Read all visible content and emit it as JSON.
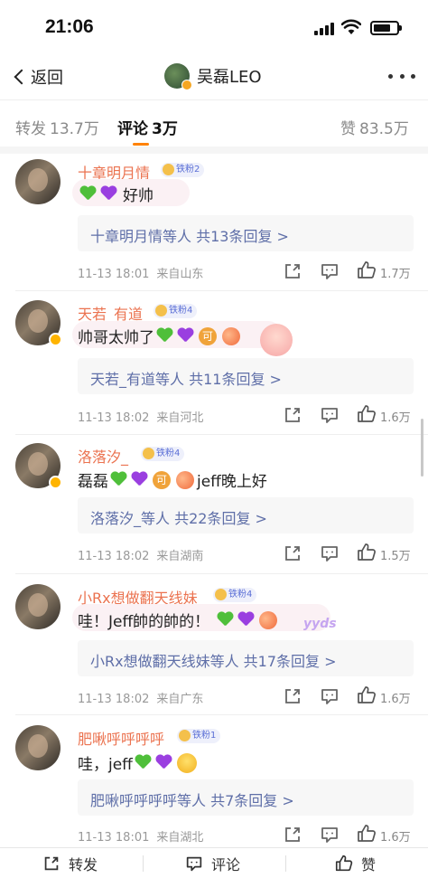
{
  "status_bar": {
    "time": "21:06"
  },
  "nav": {
    "back_label": "返回",
    "user_name": "吴磊LEO"
  },
  "tabs": {
    "repost_label": "转发",
    "repost_count": "13.7万",
    "comment_label": "评论",
    "comment_count": "3万",
    "like_label": "赞",
    "like_count": "83.5万"
  },
  "comments": [
    {
      "username": "十章明月情",
      "fan_badge": "铁粉2",
      "text": "好帅",
      "reply_summary": "十章明月情等人  共13条回复 >",
      "time": "11-13 18:01",
      "location": "来自山东",
      "likes": "1.7万"
    },
    {
      "username": "天若_有道",
      "fan_badge": "铁粉4",
      "text": "帅哥太帅了",
      "reply_summary": "天若_有道等人  共11条回复 >",
      "time": "11-13 18:02",
      "location": "来自河北",
      "likes": "1.6万"
    },
    {
      "username": "洛落汐_",
      "fan_badge": "铁粉4",
      "text_prefix": "磊磊",
      "text_suffix": "jeff晚上好",
      "reply_summary": "洛落汐_等人  共22条回复 >",
      "time": "11-13 18:02",
      "location": "来自湖南",
      "likes": "1.5万"
    },
    {
      "username": "小Rx想做翻天线妹",
      "fan_badge": "铁粉4",
      "text": "哇！Jeff帥的帥的！",
      "sticker_text": "yyds",
      "reply_summary": "小Rx想做翻天线妹等人  共17条回复 >",
      "time": "11-13 18:02",
      "location": "来自广东",
      "likes": "1.6万"
    },
    {
      "username": "肥啾呼呼呼呼",
      "fan_badge": "铁粉1",
      "text": "哇，jeff",
      "reply_summary": "肥啾呼呼呼呼等人  共7条回复 >",
      "time": "11-13 18:01",
      "location": "来自湖北",
      "likes": "1.6万"
    }
  ],
  "emoji": {
    "ke": "可"
  },
  "bottom_bar": {
    "repost_label": "转发",
    "comment_label": "评论",
    "like_label": "赞"
  },
  "icons": [
    "back-chevron-icon",
    "more-icon",
    "share-icon",
    "comment-icon",
    "like-icon",
    "verified-icon"
  ],
  "colors": {
    "accent": "#ff8200",
    "username": "#eb7350",
    "link": "#5f6fa8"
  }
}
